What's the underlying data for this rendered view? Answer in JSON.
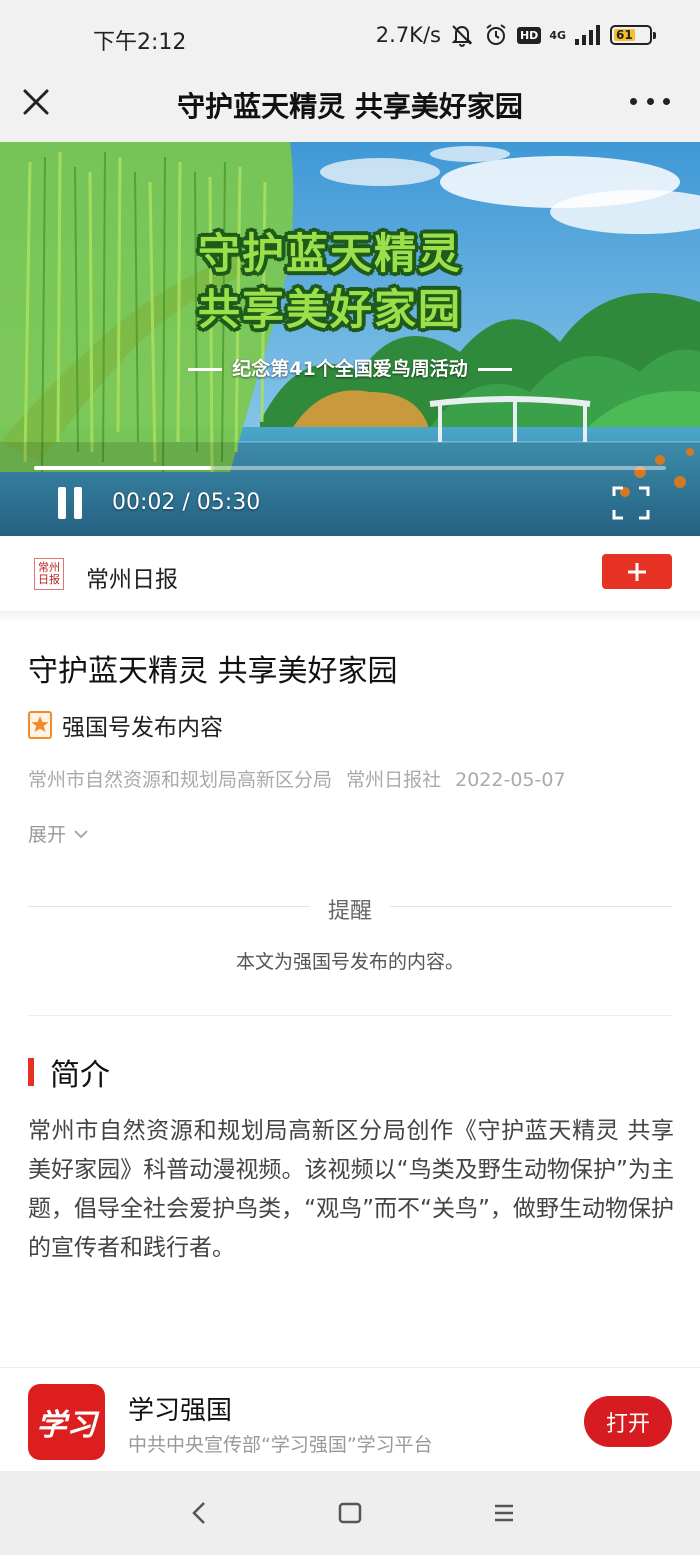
{
  "status_bar": {
    "time": "下午2:12",
    "net_speed": "2.7K/s",
    "hd_label": "HD",
    "network_label": "4G",
    "battery": "61",
    "battery_level": 0.61,
    "icons": [
      "mute-bell-icon",
      "alarm-icon",
      "hd-icon",
      "signal-icon",
      "battery-icon"
    ]
  },
  "header": {
    "title": "守护蓝天精灵 共享美好家园",
    "icons": [
      "close-icon",
      "more-icon"
    ]
  },
  "video": {
    "overlay_title_line1": "守护蓝天精灵",
    "overlay_title_line2": "共享美好家园",
    "overlay_subtitle": "纪念第41个全国爱鸟周活动",
    "time_display": "00:02 / 05:30",
    "progress": 0.0061,
    "icons": [
      "pause-icon",
      "fullscreen-icon"
    ]
  },
  "publisher": {
    "name": "常州日报",
    "logo_text": "常州日报",
    "follow_icon": "plus-icon"
  },
  "article": {
    "title": "守护蓝天精灵 共享美好家园",
    "source_label": "强国号发布内容",
    "meta_author": "常州市自然资源和规划局高新区分局",
    "meta_org": "常州日报社",
    "meta_date": "2022-05-07",
    "expand_label": "展开"
  },
  "notice": {
    "title": "提醒",
    "text": "本文为强国号发布的内容。"
  },
  "summary": {
    "heading": "简介",
    "body": "常州市自然资源和规划局高新区分局创作《守护蓝天精灵 共享美好家园》科普动漫视频。该视频以“鸟类及野生动物保护”为主题，倡导全社会爱护鸟类，“观鸟”而不“关鸟”，做野生动物保护的宣传者和践行者。"
  },
  "app_banner": {
    "icon_text": "学习",
    "name": "学习强国",
    "description": "中共中央宣传部“学习强国”学习平台",
    "open_label": "打开"
  },
  "colors": {
    "accent": "#e53222",
    "open_button": "#d61c20",
    "muted_text": "#aaaaaa"
  },
  "nav_bar": {
    "icons": [
      "back-icon",
      "home-icon",
      "recents-icon"
    ]
  }
}
